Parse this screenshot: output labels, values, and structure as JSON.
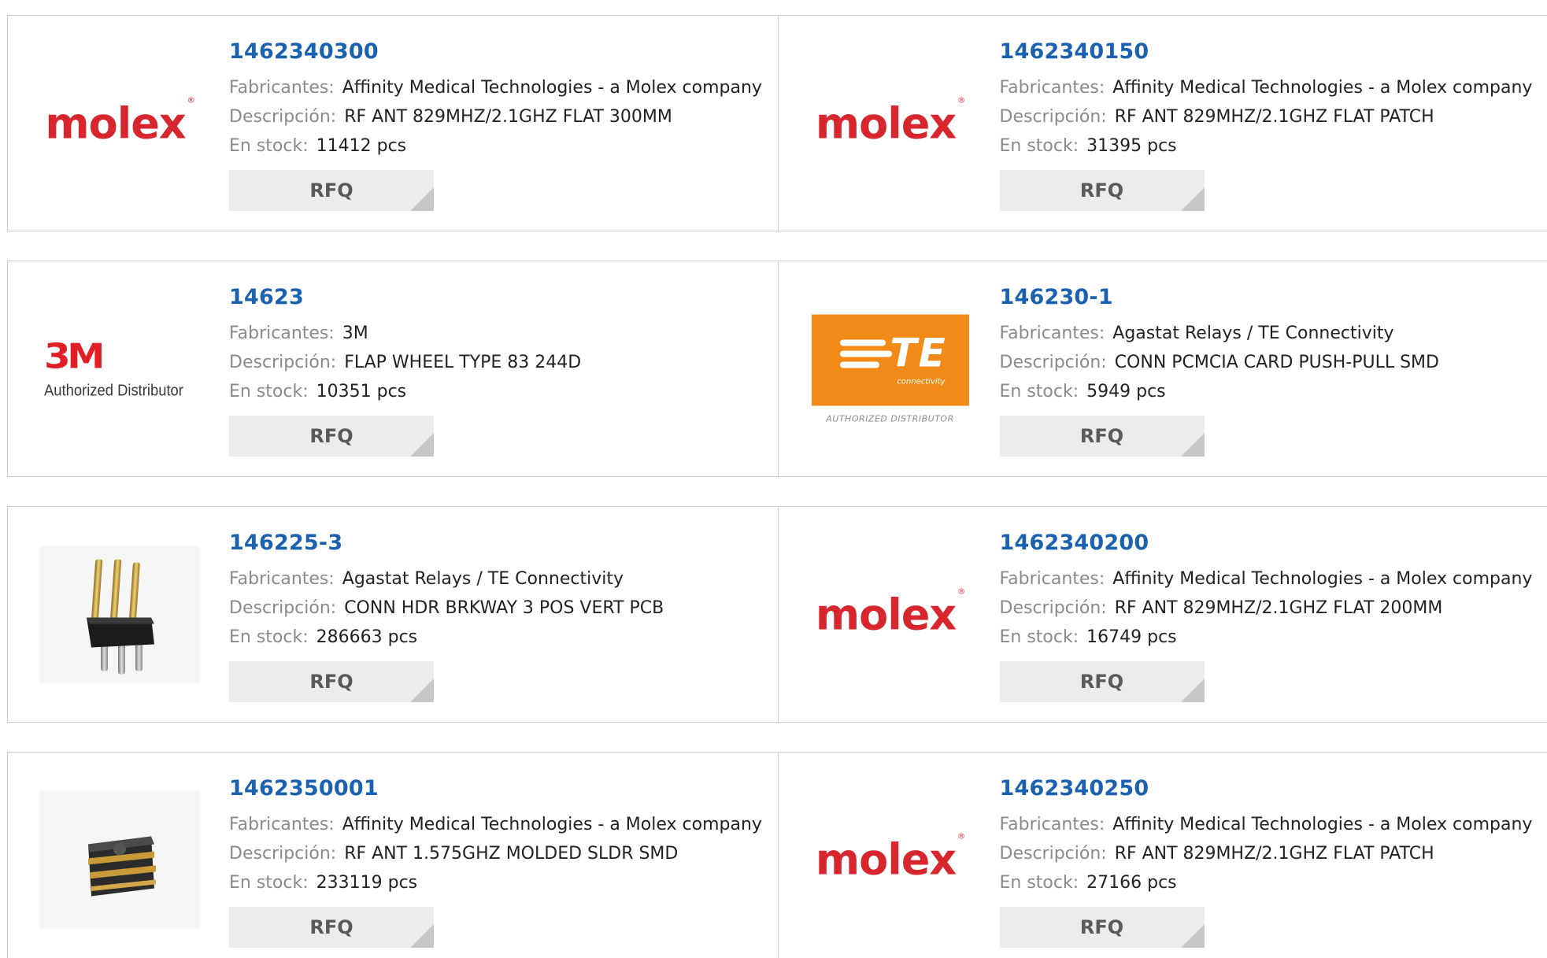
{
  "labels": {
    "manufacturer": "Fabricantes:",
    "description": "Descripción:",
    "stock": "En stock:",
    "rfq": "RFQ"
  },
  "products": [
    {
      "part": "1462340300",
      "manufacturer": "Affinity Medical Technologies - a Molex company",
      "description": "RF ANT 829MHZ/2.1GHZ FLAT 300MM",
      "stock": "11412 pcs",
      "logo": "molex-logo"
    },
    {
      "part": "1462340150",
      "manufacturer": "Affinity Medical Technologies - a Molex company",
      "description": "RF ANT 829MHZ/2.1GHZ FLAT PATCH",
      "stock": "31395 pcs",
      "logo": "molex-logo"
    },
    {
      "part": "14623",
      "manufacturer": "3M",
      "description": "FLAP WHEEL TYPE 83 244D",
      "stock": "10351 pcs",
      "logo": "3m-authorized-distributor-logo"
    },
    {
      "part": "146230-1",
      "manufacturer": "Agastat Relays / TE Connectivity",
      "description": "CONN PCMCIA CARD PUSH-PULL SMD",
      "stock": "5949 pcs",
      "logo": "te-connectivity-logo"
    },
    {
      "part": "146225-3",
      "manufacturer": "Agastat Relays / TE Connectivity",
      "description": "CONN HDR BRKWAY 3 POS VERT PCB",
      "stock": "286663 pcs",
      "logo": "pin-header-photo"
    },
    {
      "part": "1462340200",
      "manufacturer": "Affinity Medical Technologies - a Molex company",
      "description": "RF ANT 829MHZ/2.1GHZ FLAT 200MM",
      "stock": "16749 pcs",
      "logo": "molex-logo"
    },
    {
      "part": "1462350001",
      "manufacturer": "Affinity Medical Technologies - a Molex company",
      "description": "RF ANT 1.575GHZ MOLDED SLDR SMD",
      "stock": "233119 pcs",
      "logo": "chip-antenna-photo"
    },
    {
      "part": "1462340250",
      "manufacturer": "Affinity Medical Technologies - a Molex company",
      "description": "RF ANT 829MHZ/2.1GHZ FLAT PATCH",
      "stock": "27166 pcs",
      "logo": "molex-logo"
    }
  ],
  "logo_text": {
    "molex": "molex",
    "molex_mark": "®",
    "m3": "3M",
    "m3_sub": "Authorized Distributor",
    "te": "TE",
    "te_conn": "connectivity",
    "te_auth": "AUTHORIZED DISTRIBUTOR"
  },
  "colors": {
    "part_link": "#1a62b0",
    "molex_red": "#d8262e",
    "te_orange": "#f28a18",
    "label_gray": "#8a8a8a"
  }
}
